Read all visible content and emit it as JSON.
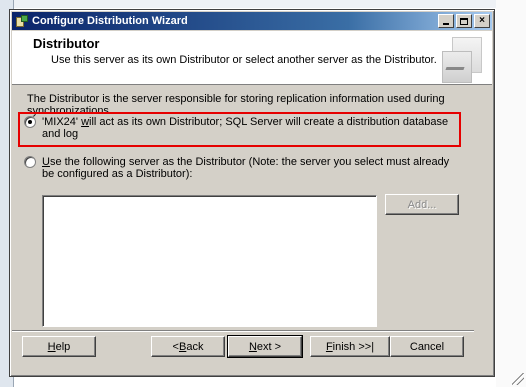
{
  "window": {
    "title": "Configure Distribution Wizard",
    "controls": {
      "minimize": "_",
      "maximize": "□",
      "close": "×"
    }
  },
  "header": {
    "title": "Distributor",
    "subtitle": "Use this server as its own Distributor or select another server as the Distributor."
  },
  "description": "The Distributor is the server responsible for storing replication information used during synchronizations.",
  "options": [
    {
      "pre": "'MIX24' ",
      "accel": "w",
      "post": "ill act as its own Distributor; SQL Server will create a distribution database and log",
      "selected": true
    },
    {
      "pre": "",
      "accel": "U",
      "post": "se the following server as the Distributor (Note: the server you select must already be configured as a Distributor):",
      "selected": false
    }
  ],
  "buttons": {
    "add": "Add...",
    "help": {
      "accel": "H",
      "rest": "elp"
    },
    "back": {
      "pre": "< ",
      "accel": "B",
      "rest": "ack"
    },
    "next": {
      "accel": "N",
      "rest": "ext >"
    },
    "finish": {
      "accel": "F",
      "rest": "inish >>|"
    },
    "cancel": "Cancel"
  },
  "highlight_color": "#e60000"
}
